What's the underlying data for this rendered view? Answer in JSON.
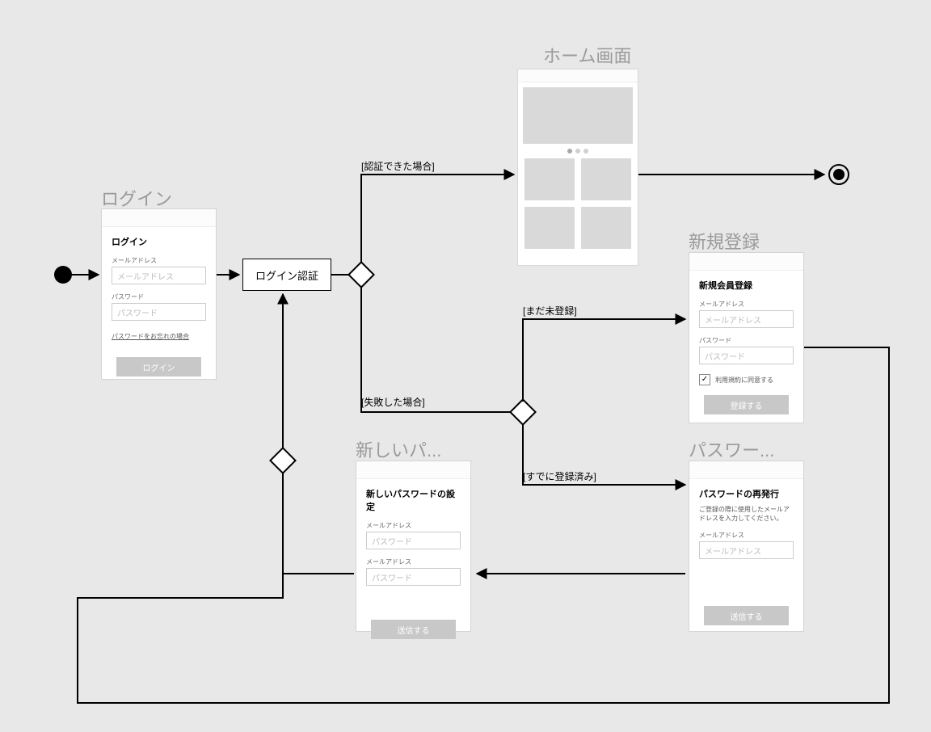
{
  "titles": {
    "login": "ログイン",
    "home": "ホーム画面",
    "register": "新規登録",
    "newpass": "新しいパ...",
    "reissue": "パスワー..."
  },
  "process": {
    "login_auth": "ログイン認証"
  },
  "edges": {
    "auth_success": "[認証できた場合]",
    "auth_fail": "[失敗した場合]",
    "not_registered": "[まだ未登録]",
    "already_registered": "[すでに登録済み]"
  },
  "login_screen": {
    "header": "ログイン",
    "email_label": "メールアドレス",
    "email_ph": "メールアドレス",
    "pass_label": "パスワード",
    "pass_ph": "パスワード",
    "forgot": "パスワードをお忘れの場合",
    "btn": "ログイン"
  },
  "register_screen": {
    "header": "新規会員登録",
    "email_label": "メールアドレス",
    "email_ph": "メールアドレス",
    "pass_label": "パスワード",
    "pass_ph": "パスワード",
    "agree": "利用規約に同意する",
    "btn": "登録する"
  },
  "newpass_screen": {
    "header": "新しいパスワードの設定",
    "label1": "メールアドレス",
    "ph1": "パスワード",
    "label2": "メールアドレス",
    "ph2": "パスワード",
    "btn": "送信する"
  },
  "reissue_screen": {
    "header": "パスワードの再発行",
    "caption": "ご登録の際に使用したメールアドレスを入力してください。",
    "email_label": "メールアドレス",
    "email_ph": "メールアドレス",
    "btn": "送信する"
  }
}
